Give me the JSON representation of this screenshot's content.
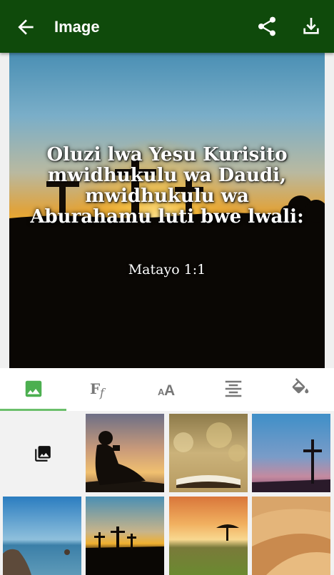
{
  "app_bar": {
    "title": "Image",
    "background_color": "#0f4a0b",
    "left_icon": "arrow-back-icon",
    "right_icons": [
      "share-icon",
      "download-icon"
    ]
  },
  "preview": {
    "verse_text": "Oluzi lwa Yesu Kurisito mwidhukulu wa Daudi, mwidhukulu wa Aburahamu luti bwe lwali:",
    "reference": "Matayo 1:1",
    "background": "sunset-three-crosses"
  },
  "editor_tabs": [
    {
      "icon": "image-icon",
      "selected": true
    },
    {
      "icon": "font-family-icon",
      "selected": false
    },
    {
      "icon": "text-size-icon",
      "selected": false
    },
    {
      "icon": "align-center-icon",
      "selected": false
    },
    {
      "icon": "color-fill-icon",
      "selected": false
    }
  ],
  "accent_color": "#4caf50",
  "background_grid": [
    {
      "kind": "gallery-picker",
      "icon": "photo-library-icon"
    },
    {
      "kind": "thumbnail",
      "subject": "boy-reading-silhouette"
    },
    {
      "kind": "thumbnail",
      "subject": "open-bible-bokeh"
    },
    {
      "kind": "thumbnail",
      "subject": "cross-dusk"
    },
    {
      "kind": "thumbnail",
      "subject": "sea-rocks"
    },
    {
      "kind": "thumbnail",
      "subject": "three-crosses-sunset"
    },
    {
      "kind": "thumbnail",
      "subject": "savanna-tree-sunset"
    },
    {
      "kind": "thumbnail",
      "subject": "desert-dunes"
    }
  ]
}
